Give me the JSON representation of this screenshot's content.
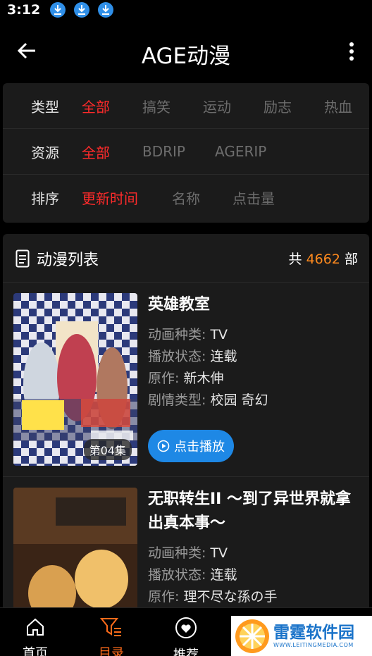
{
  "status": {
    "time": "3:12"
  },
  "appbar": {
    "title": "AGE动漫"
  },
  "filters": {
    "type": {
      "label": "类型",
      "options": [
        "全部",
        "搞笑",
        "运动",
        "励志",
        "热血"
      ]
    },
    "source": {
      "label": "资源",
      "options": [
        "全部",
        "BDRIP",
        "AGERIP"
      ]
    },
    "sort": {
      "label": "排序",
      "options": [
        "更新时间",
        "名称",
        "点击量"
      ]
    }
  },
  "list": {
    "title": "动漫列表",
    "count_prefix": "共",
    "count": "4662",
    "count_suffix": "部",
    "items": [
      {
        "name": "英雄教室",
        "episode_badge": "第04集",
        "type_label": "动画种类:",
        "type": "TV",
        "status_label": "播放状态:",
        "status": "连载",
        "author_label": "原作:",
        "author": "新木伸",
        "genre_label": "剧情类型:",
        "genre": "校园 奇幻",
        "play_label": "点击播放"
      },
      {
        "name": "无职转生II ～到了异世界就拿出真本事～",
        "type_label": "动画种类:",
        "type": "TV",
        "status_label": "播放状态:",
        "status": "连载",
        "author_label": "原作:",
        "author": "理不尽な孫の手"
      }
    ]
  },
  "nav": {
    "home": "首页",
    "catalog": "目录",
    "recommend": "推荐"
  },
  "watermark": {
    "brand": "雷霆软件园",
    "url": "WWW.LEITINGMEDIA.COM"
  },
  "colors": {
    "accent_red": "#ff2b2b",
    "accent_orange": "#ff8a1e",
    "play_blue": "#1e88e5"
  }
}
